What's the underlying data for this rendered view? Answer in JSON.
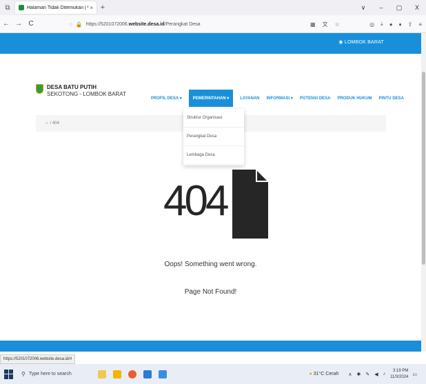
{
  "browser": {
    "tab_title": "Halaman Tidak Ditemukan | Wi",
    "tab_close": "×",
    "new_tab": "+",
    "url_scheme": "https://",
    "url_host_prefix": "5201072006.",
    "url_host": "website.desa.id",
    "url_path": "/Perangkat Desa",
    "back": "←",
    "forward": "→",
    "reload": "C",
    "minimize": "–",
    "maximize": "▢",
    "close": "X",
    "dropdown": "∨"
  },
  "site": {
    "region_label": "LOMBOK BARAT",
    "brand_name": "DESA BATU PUTIH",
    "brand_sub": "SEKOTONG - LOMBOK BARAT",
    "nav": [
      {
        "label": "PROFIL DESA ▾"
      },
      {
        "label": "PEMERINTAHAN ▾"
      },
      {
        "label": "LAYANAN"
      },
      {
        "label": "INFORMASI ▾"
      },
      {
        "label": "POTENSI DESA"
      },
      {
        "label": "PRODUK HUKUM"
      },
      {
        "label": "PINTU DESA"
      }
    ],
    "breadcrumb_current": "/ 404",
    "dropdown": [
      {
        "label": "Struktur Organisasi"
      },
      {
        "label": "Perangkat Desa"
      },
      {
        "label": "Lembaga Desa"
      }
    ],
    "error_code": "404",
    "message": "Oops! Something went wrong.",
    "submessage": "Page Not Found!"
  },
  "status_url": "https://5201072006.website.desa.id/#",
  "taskbar": {
    "search_placeholder": "Type here to search",
    "weather": "31°C Cerah",
    "time": "3:19 PM",
    "date": "11/3/2024"
  },
  "colors": {
    "accent": "#1a8fd9",
    "text_dark": "#262626"
  }
}
